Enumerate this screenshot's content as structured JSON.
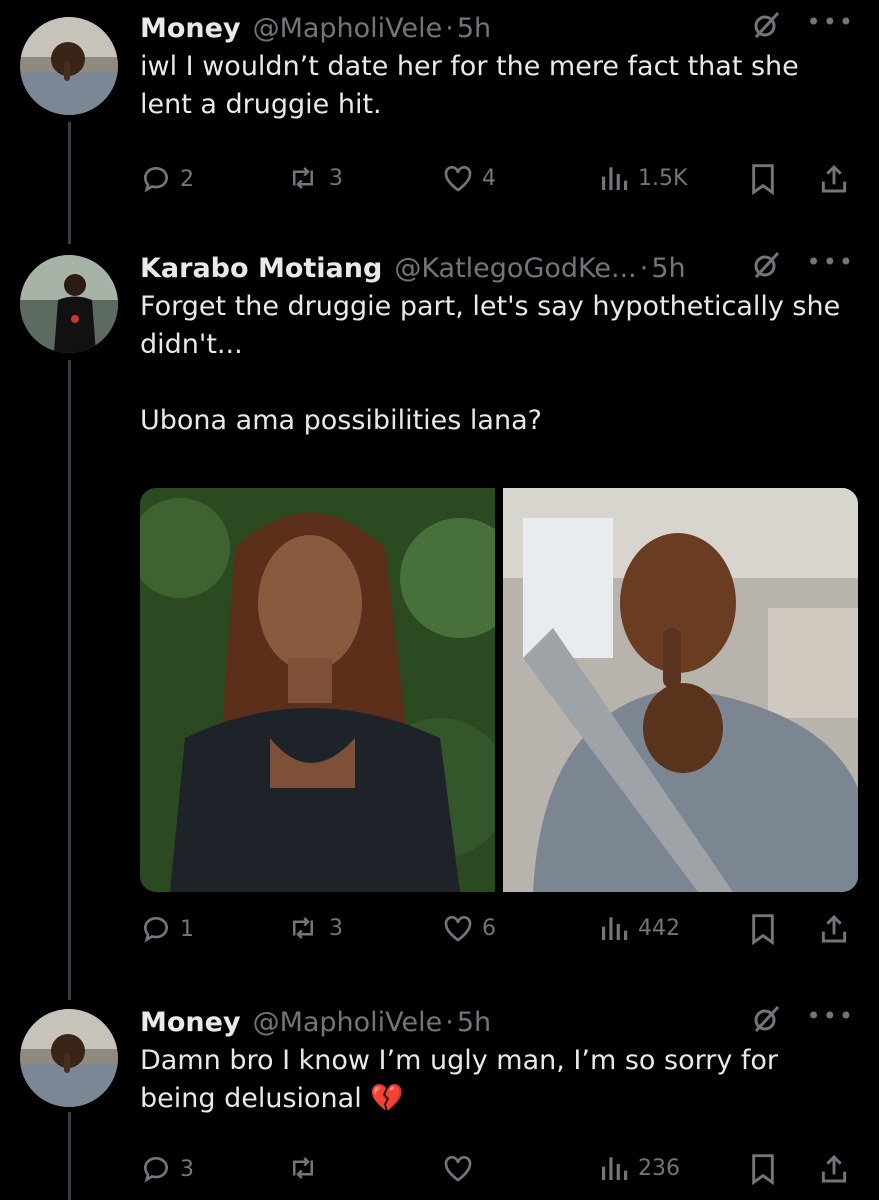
{
  "tweets": [
    {
      "name": "Money",
      "handle": "@MapholiVele",
      "time": "5h",
      "text": "iwl I wouldn’t date her for the mere fact that she lent a druggie hit.",
      "replies": "2",
      "reposts": "3",
      "likes": "4",
      "views": "1.5K"
    },
    {
      "name": "Karabo Motiang",
      "handle": "@KatlegoGodKe...",
      "time": "5h",
      "text": "Forget the druggie part, let's say hypothetically she didn't...\n\nUbona ama possibilities lana?",
      "replies": "1",
      "reposts": "3",
      "likes": "6",
      "views": "442"
    },
    {
      "name": "Money",
      "handle": "@MapholiVele",
      "time": "5h",
      "text": "Damn bro I know I’m ugly man, I’m so sorry for being delusional 💔",
      "replies": "3",
      "reposts": "",
      "likes": "",
      "views": "236"
    }
  ],
  "colors": {
    "background": "#000000",
    "muted": "#71767b",
    "text": "#e7e9ea",
    "thread_line": "#3b3f44"
  }
}
